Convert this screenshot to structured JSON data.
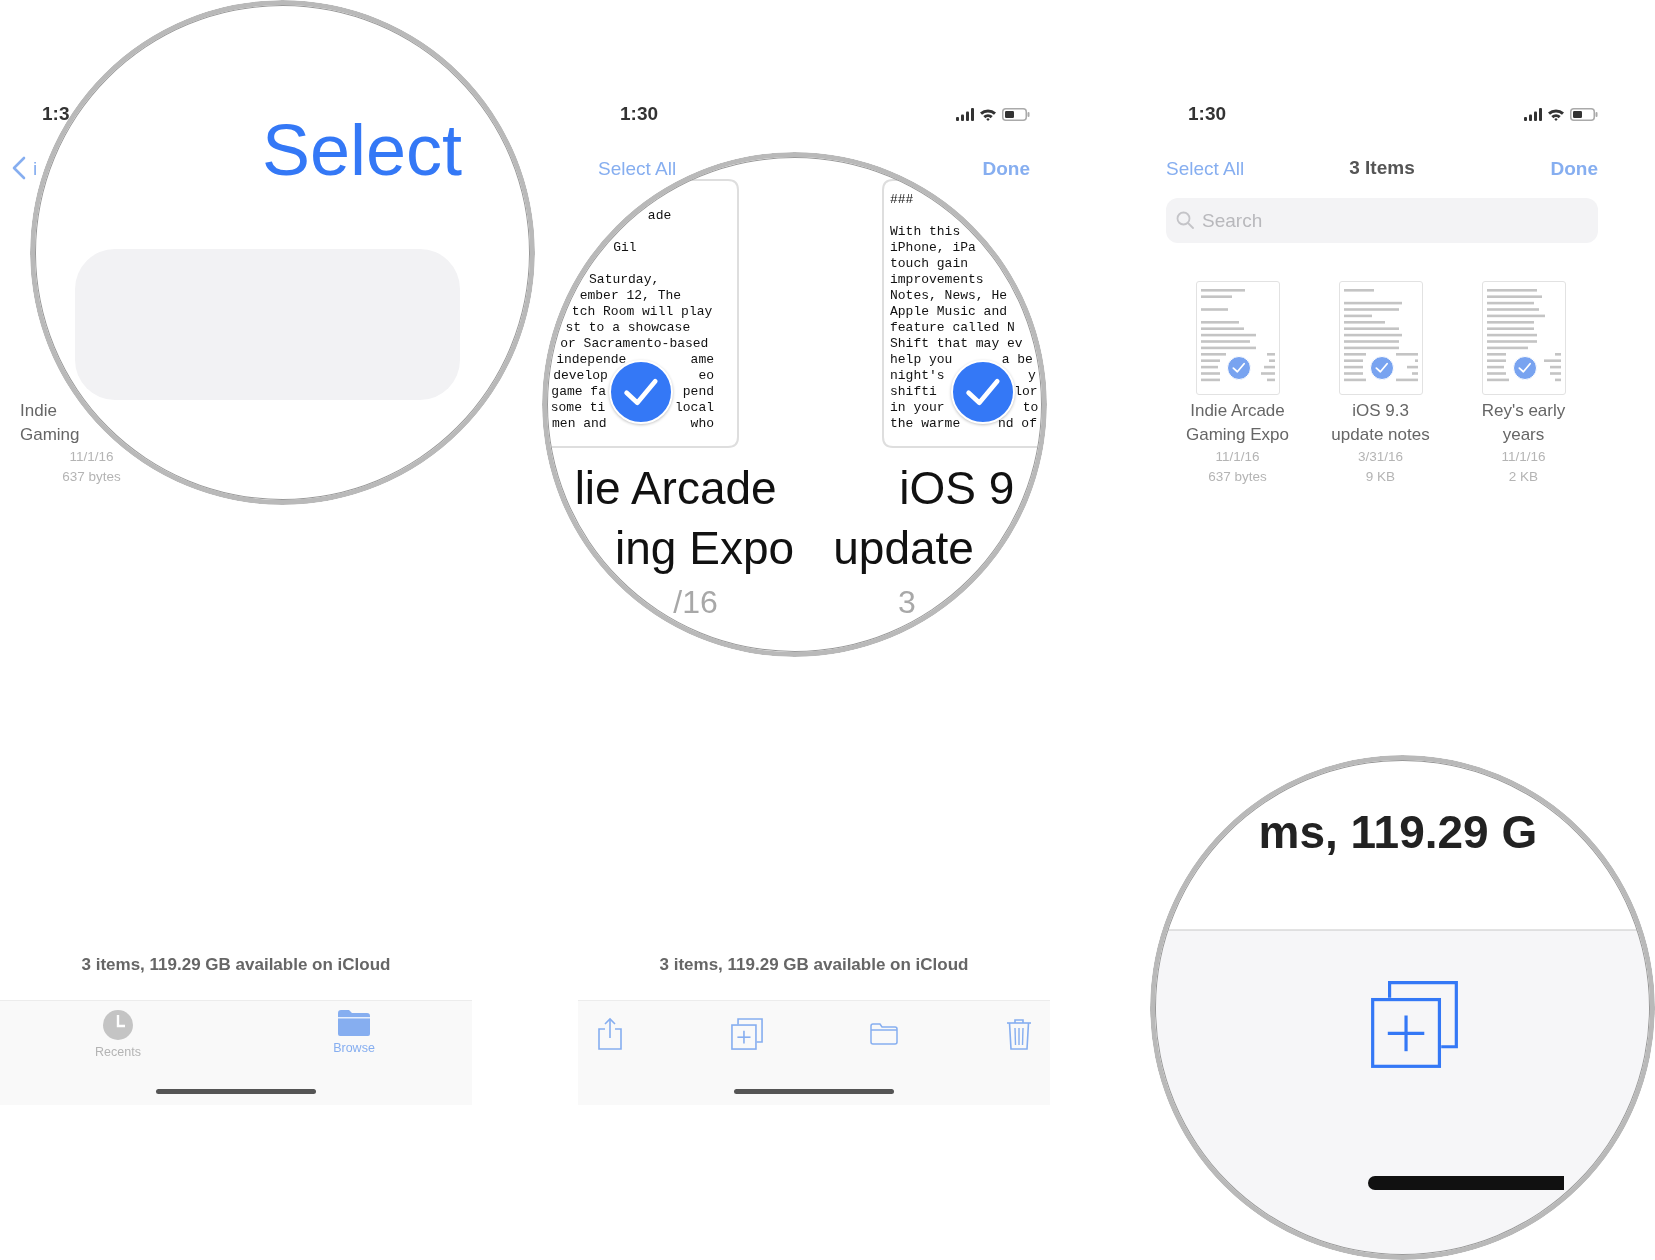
{
  "panels": [
    {
      "kind": "browse",
      "time": "1:3",
      "back_label": "i",
      "files": [
        {
          "title_lines": [
            "Indie",
            "Gaming"
          ],
          "date": "11/1/16",
          "size": "637 bytes"
        }
      ],
      "footer": "3 items, 119.29 GB available on iCloud",
      "tabs": [
        {
          "label": "Recents",
          "selected": false
        },
        {
          "label": "Browse",
          "selected": true
        }
      ]
    },
    {
      "kind": "select_actions",
      "time": "1:30",
      "select_all": "Select All",
      "done": "Done",
      "footer": "3 items, 119.29 GB available on iCloud"
    },
    {
      "kind": "select",
      "time": "1:30",
      "select_all": "Select All",
      "title": "3 Items",
      "done": "Done",
      "search": {
        "placeholder": "Search"
      },
      "files": [
        {
          "title_lines": [
            "Indie Arcade",
            "Gaming Expo"
          ],
          "date": "11/1/16",
          "size": "637 bytes",
          "selected": true
        },
        {
          "title_lines": [
            "iOS 9.3",
            "update notes"
          ],
          "date": "3/31/16",
          "size": "9 KB",
          "selected": true
        },
        {
          "title_lines": [
            "Rey's early",
            "years"
          ],
          "date": "11/1/16",
          "size": "2 KB",
          "selected": true
        }
      ]
    }
  ],
  "magnifiers": [
    {
      "kind": "button",
      "label": "Select"
    },
    {
      "kind": "documents",
      "docs": [
        {
          "blocks": [
            [
              "ade"
            ],
            [
              "Gil"
            ],
            [
              "Saturday,",
              "ember 12, The",
              "tch Room will play",
              "st to a showcase",
              "or Sacramento-based"
            ]
          ],
          "split": [
            {
              "left": "independe",
              "right": "ame"
            },
            {
              "left": "develop",
              "right": "eo"
            },
            {
              "left": "game fa",
              "right": "pend"
            },
            {
              "left": "some ti",
              "right": "local"
            },
            {
              "left": "men and",
              "right": "who"
            }
          ],
          "title_lines": [
            "lie Arcade",
            "ing Expo"
          ],
          "date": "/16",
          "selected": true
        },
        {
          "blocks": [
            [
              "###"
            ],
            [
              "With this",
              "iPhone, iPa",
              "touch gain",
              "improvements",
              "Notes, News, He",
              "Apple Music and",
              "feature called N",
              "Shift that may ev"
            ]
          ],
          "split": [
            {
              "left": "help you",
              "right": "a be"
            },
            {
              "left": "night's",
              "right": "y"
            },
            {
              "left": "shifti",
              "right": "lor"
            },
            {
              "left": "in your",
              "right": "to"
            },
            {
              "left": "the warme",
              "right": "nd of"
            }
          ],
          "title_lines": [
            "iOS 9",
            "update"
          ],
          "date": "3",
          "selected": true
        }
      ]
    },
    {
      "kind": "toolbar",
      "caption": "ms, 119.29 G"
    }
  ]
}
